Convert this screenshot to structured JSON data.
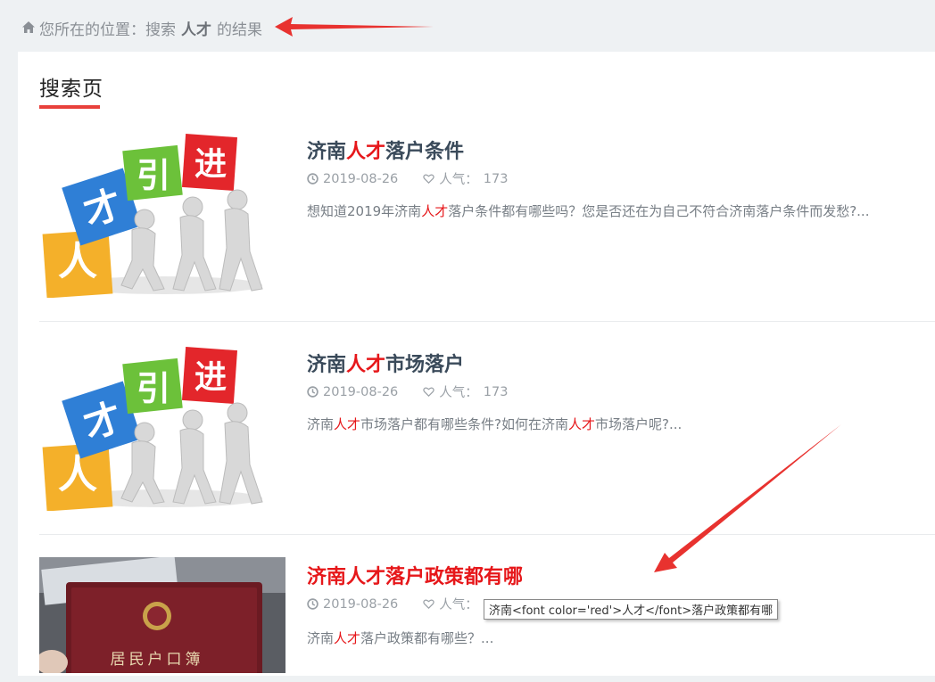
{
  "breadcrumb": {
    "prefix": "您所在的位置：搜索",
    "keyword": "人才",
    "suffix": "的结果"
  },
  "page": {
    "title": "搜索页"
  },
  "results": [
    {
      "title_pre": "济南",
      "title_hl": "人才",
      "title_post": "落户条件",
      "date": "2019-08-26",
      "views_label": "人气：",
      "views": "173",
      "excerpt_pre": "想知道2019年济南",
      "excerpt_hl": "人才",
      "excerpt_post": "落户条件都有哪些吗？您是否还在为自己不符合济南落户条件而发愁?..."
    },
    {
      "title_pre": "济南",
      "title_hl": "人才",
      "title_post": "市场落户",
      "date": "2019-08-26",
      "views_label": "人气：",
      "views": "173",
      "excerpt_pre": "济南",
      "excerpt_hl": "人才",
      "excerpt_mid": "市场落户都有哪些条件?如何在济南",
      "excerpt_hl2": "人才",
      "excerpt_post": "市场落户呢?..."
    },
    {
      "title": "济南人才落户政策都有哪",
      "date": "2019-08-26",
      "views_label": "人气：",
      "excerpt_pre": "济南",
      "excerpt_hl": "人才",
      "excerpt_post": "落户政策都有哪些？..."
    }
  ],
  "thumb_blocks": {
    "a": "人",
    "b": "才",
    "c": "引",
    "d": "进"
  },
  "thumb3_text": "居民户口簿",
  "tooltip": "济南<font color='red'>人才</font>落户政策都有哪",
  "colors": {
    "accent": "#e6171a",
    "underline": "#e8403b",
    "annotation_arrow": "#e8322f"
  },
  "icons": {
    "home": "home-icon",
    "clock": "clock-icon",
    "heart": "heart-icon"
  }
}
